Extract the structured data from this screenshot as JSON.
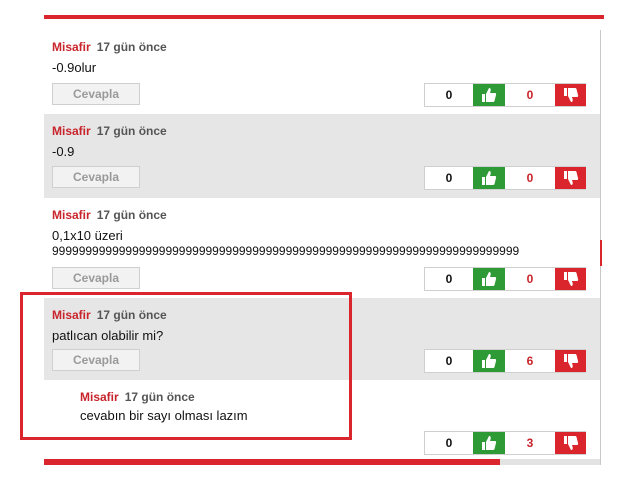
{
  "comments": [
    {
      "author": "Misafir",
      "time": "17 gün önce",
      "text": "-0.9olur",
      "text2": "",
      "reply_label": "Cevapla",
      "likes": "0",
      "dislikes": "0"
    },
    {
      "author": "Misafir",
      "time": "17 gün önce",
      "text": "-0.9",
      "text2": "",
      "reply_label": "Cevapla",
      "likes": "0",
      "dislikes": "0"
    },
    {
      "author": "Misafir",
      "time": "17 gün önce",
      "text": "0,1x10 üzeri",
      "text2": "9999999999999999999999999999999999999999999999999999999999999999999999",
      "reply_label": "Cevapla",
      "likes": "0",
      "dislikes": "0"
    },
    {
      "author": "Misafir",
      "time": "17 gün önce",
      "text": "patlıcan olabilir mi?",
      "text2": "",
      "reply_label": "Cevapla",
      "likes": "0",
      "dislikes": "6"
    }
  ],
  "reply": {
    "author": "Misafir",
    "time": "17 gün önce",
    "text": "cevabın bir sayı olması lazım",
    "likes": "0",
    "dislikes": "3"
  },
  "colors": {
    "accent": "#d9252b",
    "like": "#2e9a35",
    "alt_background": "#e6e6e6"
  },
  "icons": {
    "like": "thumbs-up-icon",
    "dislike": "thumbs-down-icon"
  },
  "scroll_progress": 0.82
}
